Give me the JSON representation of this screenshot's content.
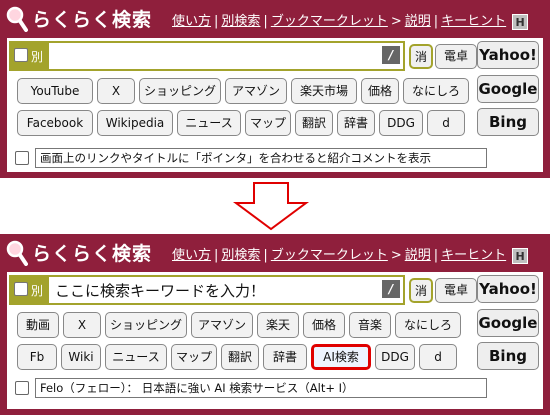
{
  "colors": {
    "brand": "#8f1f3c",
    "accent": "#a3a32c",
    "highlight_border": "#e00000"
  },
  "icons": {
    "logo": "magnifier-icon",
    "arrow": "down-arrow-icon"
  },
  "before": {
    "app_title": "らくらく検索",
    "nav": {
      "usage": "使い方",
      "alt_search": "別検索",
      "bookmarklet": "ブックマークレット",
      "arrow": ">",
      "explain": "説明",
      "keyhint": "キーヒント",
      "help": "H"
    },
    "search": {
      "betsu": "別",
      "value": "",
      "slash": "/",
      "clear": "消",
      "calculator": "電卓"
    },
    "engines": [
      "Yahoo!",
      "Google",
      "Bing"
    ],
    "row1": [
      "YouTube",
      "X",
      "ショッピング",
      "アマゾン",
      "楽天市場",
      "価格",
      "なにしろ"
    ],
    "row2": [
      "Facebook",
      "Wikipedia",
      "ニュース",
      "マップ",
      "翻訳",
      "辞書",
      "DDG",
      "d"
    ],
    "tooltip": "画面上のリンクやタイトルに「ポインタ」を合わせると紹介コメントを表示"
  },
  "after": {
    "app_title": "らくらく検索",
    "nav": {
      "usage": "使い方",
      "alt_search": "別検索",
      "bookmarklet": "ブックマークレット",
      "arrow": ">",
      "explain": "説明",
      "keyhint": "キーヒント",
      "help": "H"
    },
    "search": {
      "betsu": "別",
      "value": "ここに検索キーワードを入力！",
      "slash": "/",
      "clear": "消",
      "calculator": "電卓"
    },
    "engines": [
      "Yahoo!",
      "Google",
      "Bing"
    ],
    "row1": [
      "動画",
      "X",
      "ショッピング",
      "アマゾン",
      "楽天",
      "価格",
      "音楽",
      "なにしろ"
    ],
    "row2": [
      "Fb",
      "Wiki",
      "ニュース",
      "マップ",
      "翻訳",
      "辞書",
      "AI検索",
      "DDG",
      "d"
    ],
    "tooltip": "Felo（フェロー）： 日本語に強い AI 検索サービス（Alt+ I）"
  }
}
